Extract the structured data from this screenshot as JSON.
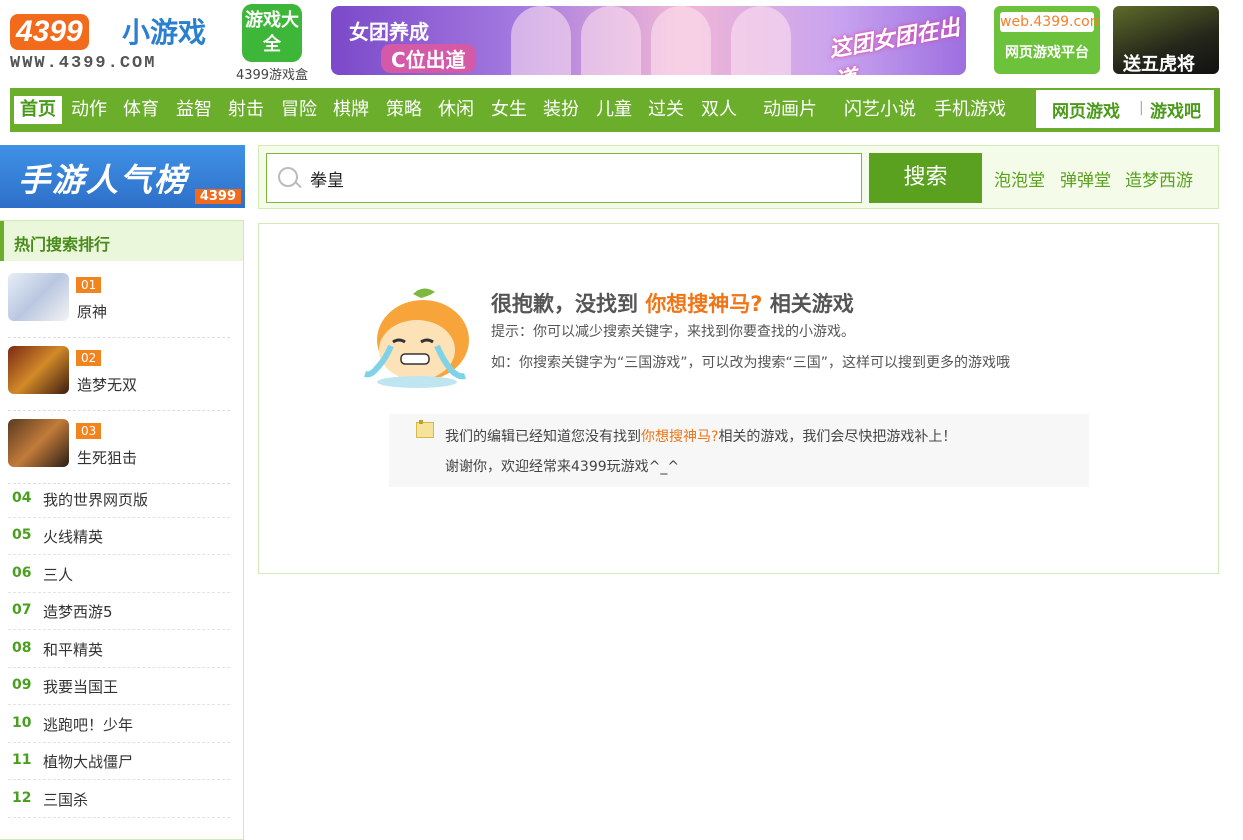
{
  "header": {
    "logo_number": "4399",
    "logo_text": "小游戏",
    "logo_url": "WWW.4399.COM",
    "gamebox_icon_text": "游戏大全",
    "gamebox_label": "4399游戏盒",
    "banner_line1": "女团养成",
    "banner_line2": "C位出道",
    "banner_slogan": "这团女团在出道",
    "webgame_top": "web.4399.com",
    "webgame_bottom": "网页游戏平台",
    "ad_right": "送五虎将"
  },
  "nav": {
    "items": [
      "首页",
      "动作",
      "体育",
      "益智",
      "射击",
      "冒险",
      "棋牌",
      "策略",
      "休闲",
      "女生",
      "装扮",
      "儿童",
      "过关",
      "双人",
      "动画片",
      "闪艺小说",
      "手机游戏"
    ],
    "active": "首页",
    "right_1": "网页游戏",
    "right_sep": "|",
    "right_2": "游戏吧"
  },
  "rank_banner": {
    "title": "手游人气榜",
    "badge": "4399"
  },
  "search": {
    "value": "拳皇",
    "button": "搜索",
    "hot_keywords": [
      "泡泡堂",
      "弹弹堂",
      "造梦西游"
    ]
  },
  "rank_panel": {
    "title": "热门搜索排行",
    "top": [
      {
        "rank": "01",
        "name": "原神"
      },
      {
        "rank": "02",
        "name": "造梦无双"
      },
      {
        "rank": "03",
        "name": "生死狙击"
      }
    ],
    "list": [
      {
        "rank": "04",
        "name": "我的世界网页版"
      },
      {
        "rank": "05",
        "name": "火线精英"
      },
      {
        "rank": "06",
        "name": "三人"
      },
      {
        "rank": "07",
        "name": "造梦西游5"
      },
      {
        "rank": "08",
        "name": "和平精英"
      },
      {
        "rank": "09",
        "name": "我要当国王"
      },
      {
        "rank": "10",
        "name": "逃跑吧！少年"
      },
      {
        "rank": "11",
        "name": "植物大战僵尸"
      },
      {
        "rank": "12",
        "name": "三国杀"
      }
    ]
  },
  "result": {
    "title_prefix": "很抱歉，没找到",
    "title_keyword": "你想搜神马?",
    "title_suffix": "相关游戏",
    "tip1": "提示：你可以减少搜索关键字，来找到你要查找的小游戏。",
    "tip2": "如：你搜索关键字为“三国游戏”，可以改为搜索“三国”，这样可以搜到更多的游戏哦",
    "notice_prefix": "我们的编辑已经知道您没有找到",
    "notice_keyword": "你想搜神马?",
    "notice_suffix": "相关的游戏，我们会尽快把游戏补上！",
    "notice_line2": "谢谢你，欢迎经常来4399玩游戏^_^"
  },
  "colors": {
    "brand_green": "#6aae2c",
    "accent_orange": "#f07516"
  }
}
